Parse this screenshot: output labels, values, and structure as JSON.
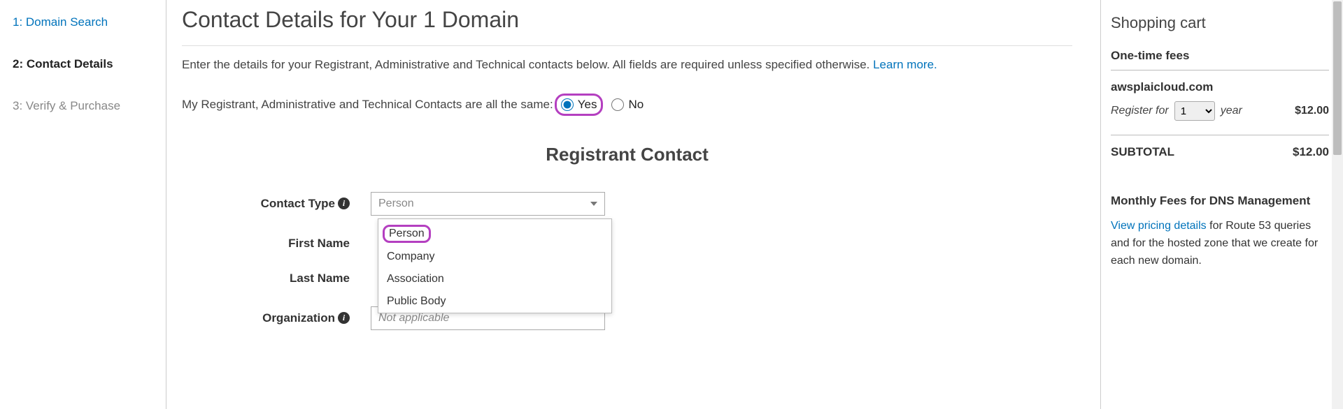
{
  "steps": {
    "s1": "1: Domain Search",
    "s2": "2: Contact Details",
    "s3": "3: Verify & Purchase"
  },
  "main": {
    "title": "Contact Details for Your 1 Domain",
    "intro_text": "Enter the details for your Registrant, Administrative and Technical contacts below. All fields are required unless specified otherwise. ",
    "learn_more": "Learn more.",
    "same_label": "My Registrant, Administrative and Technical Contacts are all the same:",
    "radio_yes": "Yes",
    "radio_no": "No",
    "section_heading": "Registrant Contact",
    "labels": {
      "contact_type": "Contact Type",
      "first_name": "First Name",
      "last_name": "Last Name",
      "organization": "Organization"
    },
    "contact_type_selected": "Person",
    "contact_type_options": [
      "Person",
      "Company",
      "Association",
      "Public Body"
    ],
    "org_placeholder": "Not applicable"
  },
  "cart": {
    "title": "Shopping cart",
    "one_time": "One-time fees",
    "domain": "awsplaicloud.com",
    "register_for": "Register for",
    "year_value": "1",
    "year_label": "year",
    "price": "$12.00",
    "subtotal_label": "SUBTOTAL",
    "subtotal_price": "$12.00",
    "monthly_label": "Monthly Fees for DNS Management",
    "view_pricing": "View pricing details",
    "pricing_rest": " for Route 53 queries and for the hosted zone that we create for each new domain."
  }
}
